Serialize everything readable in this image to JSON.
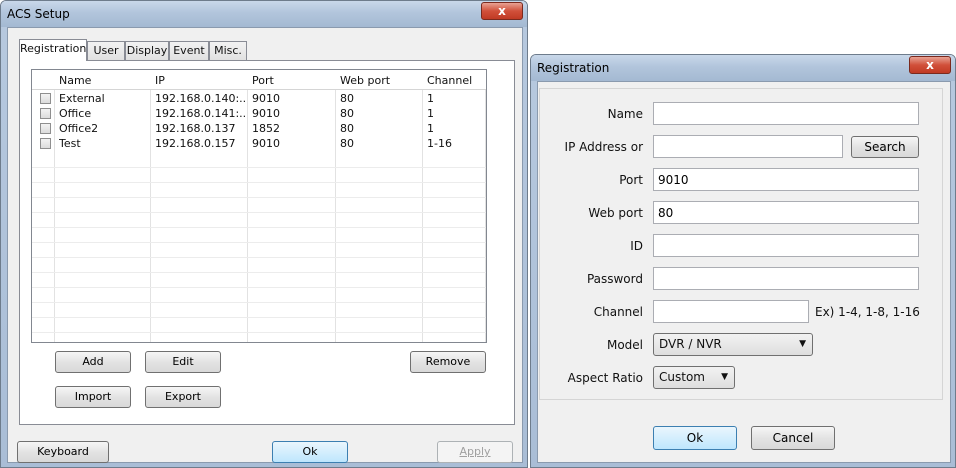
{
  "acs_window": {
    "title": "ACS Setup",
    "close_label": "x",
    "tabs": [
      {
        "label": "Registration",
        "active": true
      },
      {
        "label": "User",
        "active": false
      },
      {
        "label": "Display",
        "active": false
      },
      {
        "label": "Event",
        "active": false
      },
      {
        "label": "Misc.",
        "active": false
      }
    ],
    "columns": [
      "Name",
      "IP",
      "Port",
      "Web port",
      "Channel"
    ],
    "rows": [
      {
        "name": "External",
        "ip": "192.168.0.140:...",
        "port": "9010",
        "web_port": "80",
        "channel": "1",
        "checked": false
      },
      {
        "name": "Office",
        "ip": "192.168.0.141:...",
        "port": "9010",
        "web_port": "80",
        "channel": "1",
        "checked": false
      },
      {
        "name": "Office2",
        "ip": "192.168.0.137",
        "port": "1852",
        "web_port": "80",
        "channel": "1",
        "checked": false
      },
      {
        "name": "Test",
        "ip": "192.168.0.157",
        "port": "9010",
        "web_port": "80",
        "channel": "1-16",
        "checked": false
      }
    ],
    "buttons": {
      "add": "Add",
      "edit": "Edit",
      "remove": "Remove",
      "import": "Import",
      "export": "Export",
      "keyboard": "Keyboard",
      "ok": "Ok",
      "apply": "Apply"
    }
  },
  "registration_dialog": {
    "title": "Registration",
    "close_label": "x",
    "fields": {
      "name": {
        "label": "Name",
        "value": ""
      },
      "ip": {
        "label": "IP Address or",
        "value": ""
      },
      "port": {
        "label": "Port",
        "value": "9010"
      },
      "web_port": {
        "label": "Web port",
        "value": "80"
      },
      "id": {
        "label": "ID",
        "value": ""
      },
      "password": {
        "label": "Password",
        "value": ""
      },
      "channel": {
        "label": "Channel",
        "value": "",
        "hint": "Ex) 1-4, 1-8, 1-16"
      },
      "model": {
        "label": "Model",
        "selected": "DVR / NVR"
      },
      "aspect_ratio": {
        "label": "Aspect Ratio",
        "selected": "Custom"
      }
    },
    "search_label": "Search",
    "ok_label": "Ok",
    "cancel_label": "Cancel"
  },
  "colors": {
    "titlebar": "#b2c5dc",
    "close_button": "#d1503a",
    "client_bg": "#f0f0f0"
  }
}
